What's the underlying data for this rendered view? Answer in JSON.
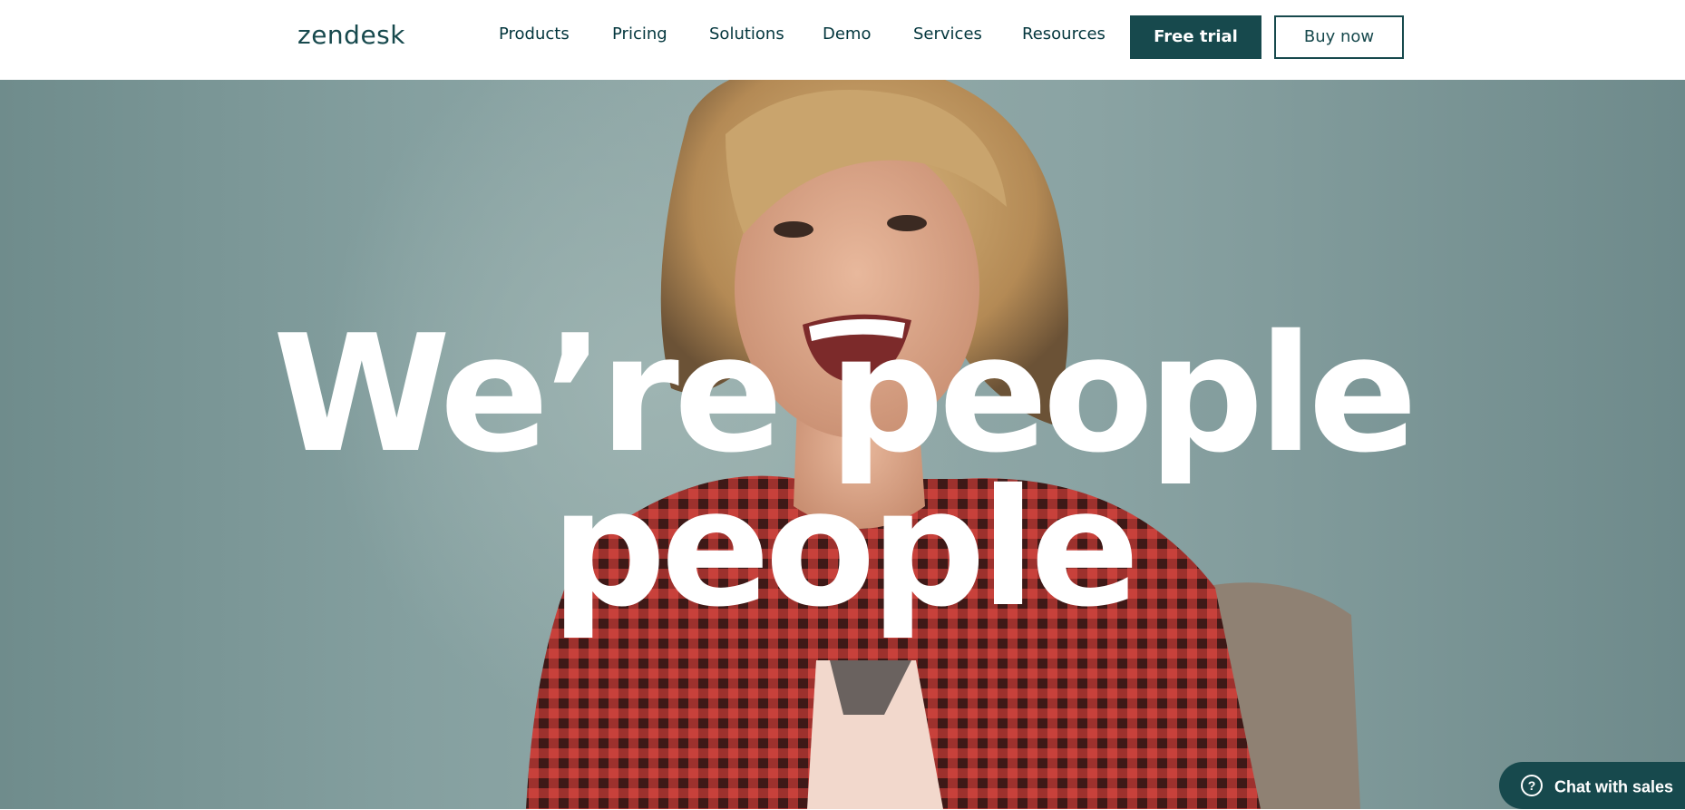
{
  "header": {
    "logo": "zendesk",
    "nav": [
      {
        "label": "Products"
      },
      {
        "label": "Pricing"
      },
      {
        "label": "Solutions"
      },
      {
        "label": "Demo"
      },
      {
        "label": "Services"
      },
      {
        "label": "Resources"
      }
    ],
    "free_trial_label": "Free trial",
    "buy_now_label": "Buy now"
  },
  "hero": {
    "headline_line1": "We’re people",
    "headline_line2": "people"
  },
  "chat": {
    "icon": "question-icon",
    "icon_glyph": "?",
    "label": "Chat with sales"
  },
  "colors": {
    "brand": "#17494d",
    "nav_text": "#03363d",
    "hero_background": "#8aa3a3"
  }
}
